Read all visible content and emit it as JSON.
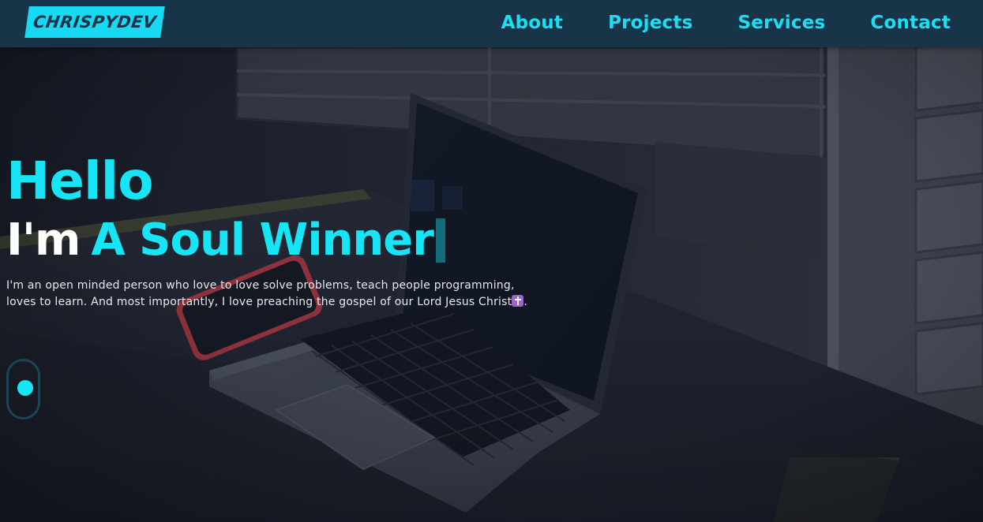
{
  "brand": {
    "logo_text": "CHRISPYDEV"
  },
  "nav": {
    "items": [
      {
        "label": "About"
      },
      {
        "label": "Projects"
      },
      {
        "label": "Services"
      },
      {
        "label": "Contact"
      }
    ]
  },
  "hero": {
    "greeting": "Hello",
    "intro_prefix": "I'm",
    "role_text": "A Soul Winner",
    "bio_line1": "I'm an open minded person who love to love solve problems, teach people programming,",
    "bio_line2": "loves to learn. And most importantly, I love preaching the gospel of our Lord Jesus Christ",
    "bio_end": "."
  },
  "icons": {
    "bio_emoji": "latin-cross-icon",
    "scroll": "scroll-indicator-icon"
  },
  "colors": {
    "accent": "#17e5f5",
    "navbar_bg": "#173448",
    "logo_text": "#173448",
    "heading_white": "#ffffff",
    "body_text": "#e6e9ee",
    "cursor": "#126c7a",
    "cross_emoji_bg": "#9a66cc"
  }
}
